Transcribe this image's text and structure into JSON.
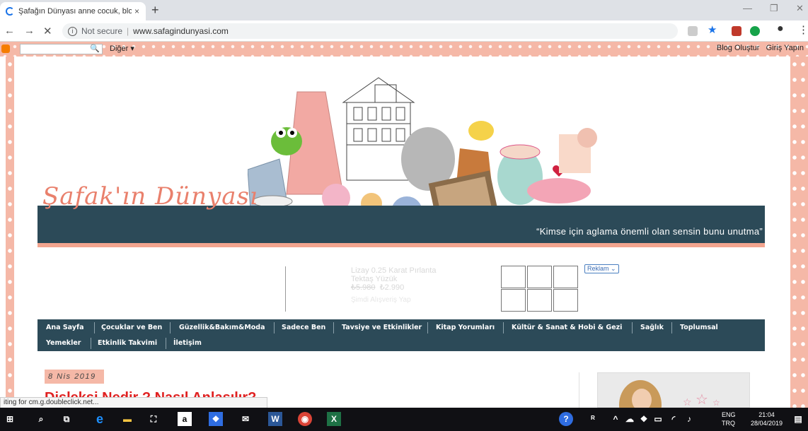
{
  "browser": {
    "tab_title": "Şafağın Dünyası anne cocuk, blo",
    "new_tab": "+",
    "close_tab": "×",
    "security": "Not secure",
    "url": "www.safagindunyasi.com"
  },
  "blogger_bar": {
    "more": "Diğer ▾",
    "create_blog": "Blog Oluştur",
    "sign_in": "Giriş Yapın"
  },
  "header": {
    "logo": "Şafak'ın Dünyası",
    "tagline": "“Kimse için aglama önemli olan sensin bunu unutma”"
  },
  "ad": {
    "title": "Lizay 0.25 Karat Pırlanta Tektaş Yüzük",
    "old_price": "₺5.980",
    "price": "₺2.990",
    "cta": "Şimdi Alışveriş Yap",
    "label": "Reklam ⌄"
  },
  "menu": [
    "Ana Sayfa",
    "Çocuklar ve Ben",
    "Güzellik&Bakım&Moda",
    "Sadece Ben",
    "Tavsiye ve Etkinlikler",
    "Kitap Yorumları",
    "Kültür & Sanat & Hobi & Gezi",
    "Sağlık",
    "Toplumsal",
    "Yemekler",
    "Etkinlik Takvimi",
    "İletişim"
  ],
  "post": {
    "date": "8 Nis 2019",
    "title": "Disleksi Nedir ? Nasıl Anlaşılır?"
  },
  "status_bar": "iting for cm.g.doubleclick.net...",
  "taskbar": {
    "lang1": "ENG",
    "lang2": "TRQ",
    "time": "21:04",
    "date": "28/04/2019"
  },
  "colors": {
    "header_band": "#2c4a58",
    "accent_pink": "#f5b8a7",
    "logo_color": "#e9806c"
  }
}
